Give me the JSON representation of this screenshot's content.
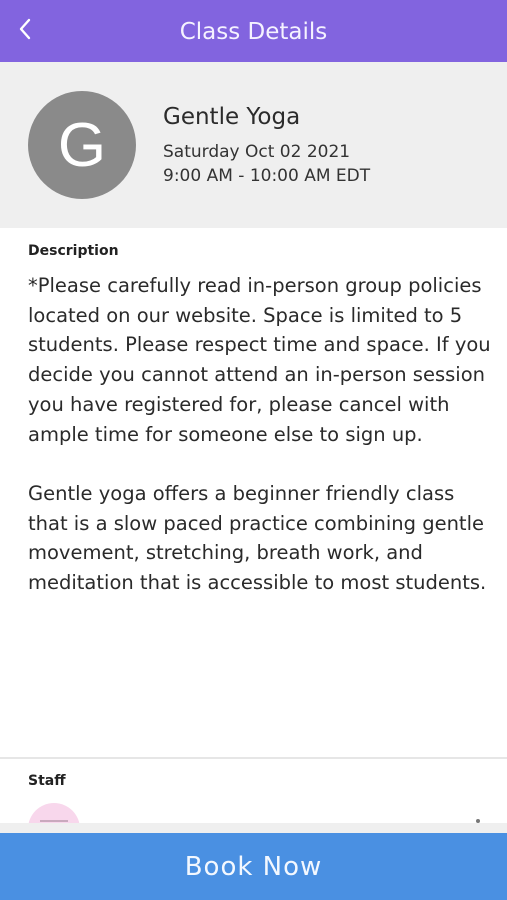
{
  "header": {
    "title": "Class Details",
    "back_icon": "chevron-left-icon",
    "background": "#8264df"
  },
  "class_info": {
    "avatar_letter": "G",
    "name": "Gentle Yoga",
    "date": "Saturday Oct 02 2021",
    "time": "9:00 AM - 10:00 AM EDT"
  },
  "description": {
    "label": "Description",
    "paragraphs": [
      "*Please carefully read in-person group policies located on our website. Space is limited to 5 students. Please respect time and space. If you decide you cannot attend an in-person session you have registered for, please cancel with ample time for someone else to sign up.",
      "Gentle yoga offers a beginner friendly class that is a slow paced practice combining gentle movement, stretching, breath work, and meditation that is accessible to most students."
    ]
  },
  "staff": {
    "label": "Staff"
  },
  "actions": {
    "book_label": "Book Now",
    "book_color": "#4a90e2"
  }
}
